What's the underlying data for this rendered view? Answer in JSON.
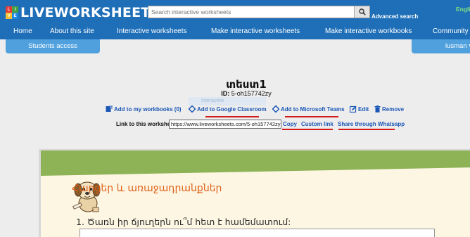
{
  "header": {
    "logo_text": "LIVEWORKSHEETS",
    "logo_mark": [
      "L",
      "I",
      "V",
      "E"
    ],
    "search_placeholder": "Search interactive worksheets",
    "advanced_search": "Advanced search",
    "language": "English"
  },
  "nav": [
    "Home",
    "About this site",
    "Interactive worksheets",
    "Make interactive worksheets",
    "Make interactive workbooks",
    "Community"
  ],
  "tabs": {
    "students": "Students access",
    "user": "lusman"
  },
  "worksheet": {
    "title": "տեստ1",
    "id_label": "ID:",
    "id_value": "5-oh157742zy",
    "faded_overlay": "Interactive"
  },
  "actions": {
    "add_workbooks": "Add to my workbooks (0)",
    "google_classroom": "Add to Google Classroom",
    "ms_teams": "Add to Microsoft Teams",
    "edit": "Edit",
    "remove": "Remove"
  },
  "link_row": {
    "label": "Link to this worksheet:",
    "url": "https://www.liveworksheets.com/5-oh157742zy",
    "copy": "Copy",
    "custom": "Custom link",
    "whatsapp": "Share through Whatsapp"
  },
  "content": {
    "heading": "Հարցեր և առաջադրանքներ",
    "question": "1. Ծառն իր ճյուղերն ու՞մ հետ է համեմատում:"
  },
  "colors": {
    "nav_blue": "#1f6fb8",
    "tab_blue": "#4fa0dd",
    "link_blue": "#1a56b6",
    "underline_red": "#d11b1b",
    "paper_green": "#8db356"
  }
}
